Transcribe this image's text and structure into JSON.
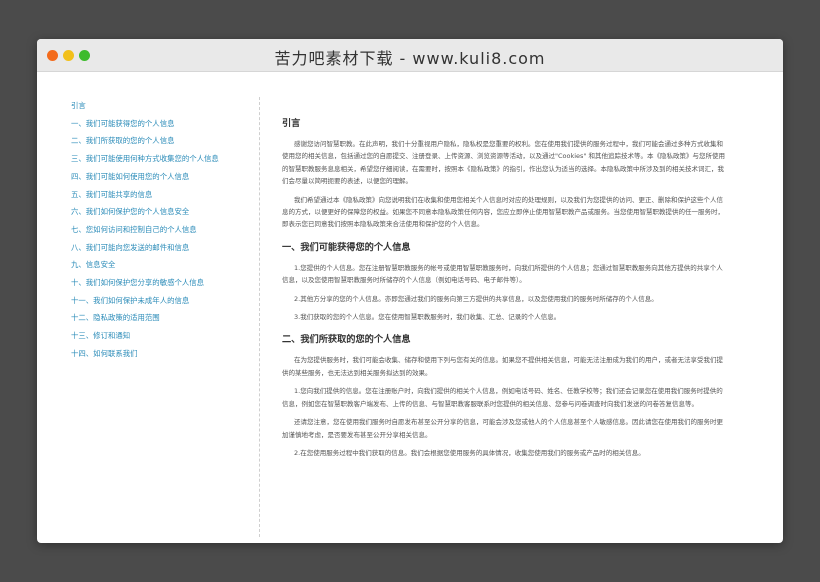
{
  "window": {
    "title": "苦力吧素材下载 - www.kuli8.com"
  },
  "toc": {
    "items": [
      "引言",
      "一、我们可能获得您的个人信息",
      "二、我们所获取的您的个人信息",
      "三、我们可能使用何种方式收集您的个人信息",
      "四、我们可能如何使用您的个人信息",
      "五、我们可能共享的信息",
      "六、我们如何保护您的个人信息安全",
      "七、您如何访问和控制自己的个人信息",
      "八、我们可能向您发送的邮件和信息",
      "九、信息安全",
      "十、我们如何保护您分享的敏感个人信息",
      "十一、我们如何保护未成年人的信息",
      "十二、隐私政策的适用范围",
      "十三、修订和通知",
      "十四、如何联系我们"
    ]
  },
  "content": {
    "intro_heading": "引言",
    "intro_p1": "感谢您访问智慧职教。在此声明，我们十分重视用户隐私，隐私权是您重要的权利。您在使用我们提供的服务过程中，我们可能会通过多种方式收集和使用您的相关信息，包括通过您的自愿提交、注册登录、上传资源、浏览资源等活动，以及通过\"Cookies\" 和其他追踪技术等。本《隐私政策》与您所使用的智慧职教服务息息相关，希望您仔细阅读，在需要时，按照本《隐私政策》的指引，作出您认为适当的选择。本隐私政策中所涉及到的相关技术词汇，我们会尽量以简明扼要的表述，以便您的理解。",
    "intro_p2": "我们希望通过本《隐私政策》向您说明我们在收集和使用您相关个人信息时对应的处理规则，以及我们为您提供的访问、更正、删除和保护这些个人信息的方式，以便更好的保障您的权益。如果您不同意本隐私政策任何内容，您应立即停止使用智慧职教产品或服务。当您使用智慧职教提供的任一服务时，即表示您已同意我们按照本隐私政策来合法使用和保护您的个人信息。",
    "s1_heading": "一、我们可能获得您的个人信息",
    "s1_p1": "1.您提供的个人信息。您在注册智慧职教服务的帐号或使用智慧职教服务时，向我们所提供的个人信息；您通过智慧职教服务向其他方提供的共享个人信息，以及您使用智慧职教服务时所储存的个人信息（例如电话号码、电子邮件等）。",
    "s1_p2": "2.其他方分享的您的个人信息。亦即您通过我们的服务向第三方提供的共享信息，以及您使用我们的服务时所储存的个人信息。",
    "s1_p3": "3.我们获取的您的个人信息。您在使用智慧职教服务时，我们收集、汇总、记录的个人信息。",
    "s2_heading": "二、我们所获取的您的个人信息",
    "s2_p1": "在为您提供服务时，我们可能会收集、储存和使用下列与您有关的信息。如果您不提供相关信息，可能无法注册成为我们的用户，或者无法享受我们提供的某些服务，也无法达到相关服务拟达到的效果。",
    "s2_p2": "1.您向我们提供的信息。您在注册账户时，向我们提供的相关个人信息，例如电话号码、姓名、任教学校等；我们还会记录您在使用我们服务时提供的信息，例如您在智慧职教客户端发布、上传的信息、与智慧职教客服联系时您提供的相关信息、您参与问卷调查时向我们发送的问卷答复信息等。",
    "s2_p3": "还请您注意，您在使用我们服务时自愿发布甚至公开分享的信息，可能会涉及您或他人的个人信息甚至个人敏感信息。因此请您在使用我们的服务时更加谨慎地考虑，是否要发布甚至公开分享相关信息。",
    "s2_p4": "2.在您使用服务过程中我们获取的信息。我们会根据您使用服务的具体情况，收集您使用我们的服务或产品时的相关信息。"
  }
}
